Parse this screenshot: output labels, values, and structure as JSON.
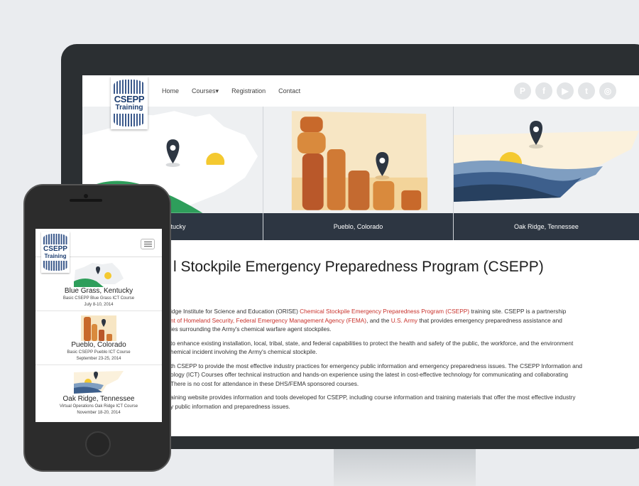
{
  "nav": {
    "logo_line1": "CSEPP",
    "logo_line2": "Training",
    "home": "Home",
    "courses": "Courses",
    "courses_caret": "▾",
    "registration": "Registration",
    "contact": "Contact"
  },
  "social": [
    {
      "name": "pinterest-icon",
      "glyph": "P"
    },
    {
      "name": "facebook-icon",
      "glyph": "f"
    },
    {
      "name": "youtube-icon",
      "glyph": "▶"
    },
    {
      "name": "twitter-icon",
      "glyph": "t"
    },
    {
      "name": "instagram-icon",
      "glyph": "◎"
    }
  ],
  "panels": [
    {
      "caption": "Kentucky"
    },
    {
      "caption": "Pueblo, Colorado"
    },
    {
      "caption": "Oak Ridge, Tennessee"
    }
  ],
  "main": {
    "title": "l Stockpile Emergency Preparedness Program (CSEPP)",
    "p1_a": "idge Institute for Science and Education (ORISE) ",
    "p1_link": "Chemical Stockpile Emergency Preparedness Program (CSEPP)",
    "p1_b": " training site. CSEPP is a partnership",
    "p1_link2": "nt of Homeland Security, Federal Emergency Management Agency (FEMA)",
    "p1_c": ", and the ",
    "p1_link3": "U.S. Army",
    "p1_d": " that provides emergency preparedness assistance and",
    "p1_e": "ies surrounding the Army's chemical warfare agent stockpiles.",
    "p2_a": "to enhance existing installation, local, tribal, state, and federal capabilities to protect the health and safety of the public, the workforce, and the environment",
    "p2_b": "hemical incident involving the Army's chemical stockpile.",
    "p3_a": "th CSEPP to provide the most effective industry practices for emergency public information and emergency preparedness issues. The CSEPP Information and",
    "p3_b": "ology (ICT) Courses offer technical instruction and hands-on experience using the latest in cost-effective technology for communicating and collaborating",
    "p3_c": "There is no cost for attendance in these DHS/FEMA sponsored courses.",
    "p4_a": "aining website provides information and tools developed for CSEPP, including course information and training materials that offer the most effective industry",
    "p4_b": "y public information and preparedness issues."
  },
  "mobile": {
    "logo_line1": "CSEPP",
    "logo_line2": "Training",
    "items": [
      {
        "location": "Blue Grass, Kentucky",
        "course": "Basic CSEPP Blue Grass ICT Course",
        "dates": "July 8-10, 2014"
      },
      {
        "location": "Pueblo, Colorado",
        "course": "Basic CSEPP Pueblo ICT Course",
        "dates": "September 23-25, 2014"
      },
      {
        "location": "Oak Ridge, Tennessee",
        "course": "Virtual Operations Oak Ridge ICT Course",
        "dates": "November 18-20, 2014"
      }
    ]
  },
  "colors": {
    "accent_link": "#c8312b",
    "caption_bar": "#2d3642",
    "logo_blue": "#1c3d70",
    "monitor": "#2b2f32"
  }
}
